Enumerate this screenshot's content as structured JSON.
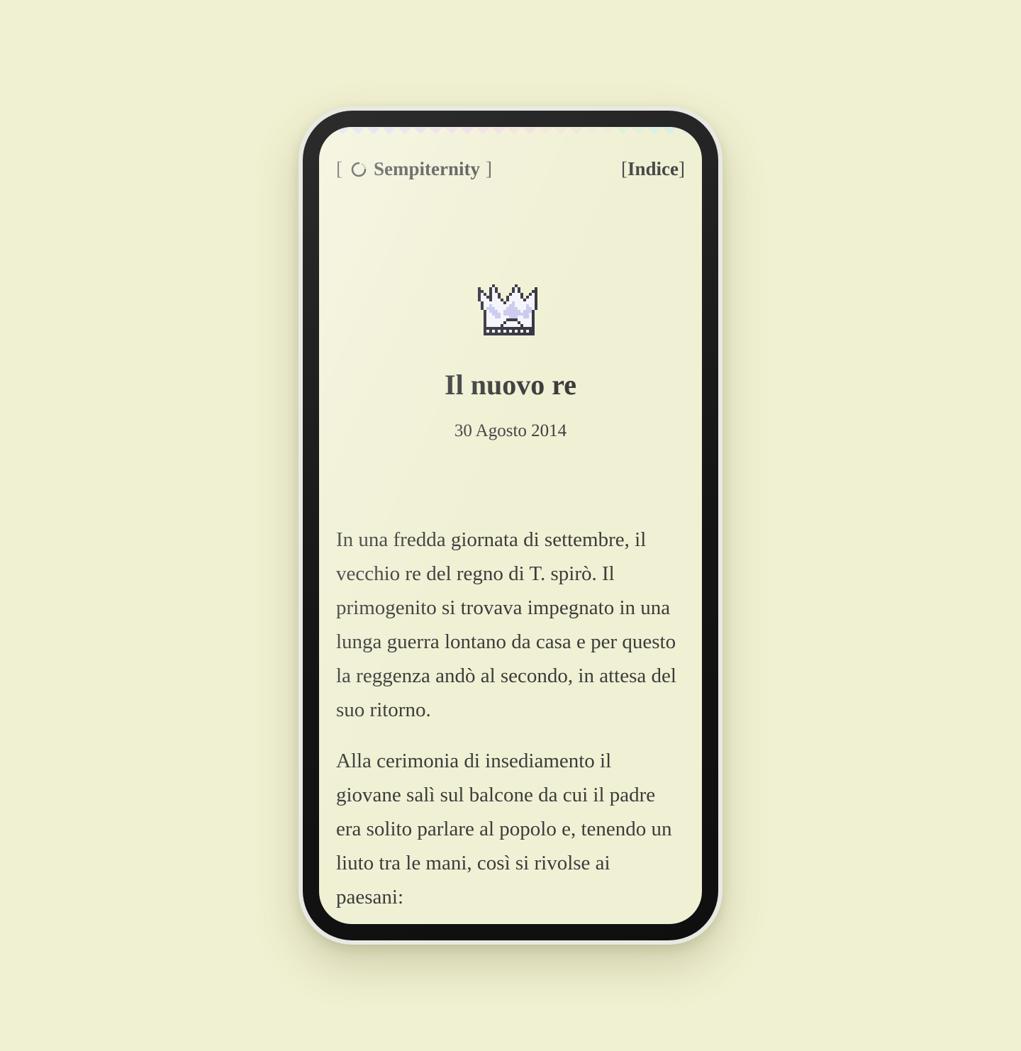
{
  "header": {
    "bracket_open": "[",
    "bracket_close": "]",
    "brand": "Sempiternity",
    "brand_icon": "loading-spinner-icon",
    "index_open": "[",
    "index_label": "Indice",
    "index_close": "]"
  },
  "post": {
    "icon": "pixel-crown-icon",
    "title": "Il nuovo re",
    "date": "30 Agosto 2014",
    "paragraphs": [
      "In una fredda giornata di settembre, il vecchio re del regno di T. spirò. Il primogenito si trovava impegnato in una lunga guerra lontano da casa e per questo la reggenza andò al secondo, in attesa del suo ritorno.",
      "Alla cerimonia di insediamento il giovane salì sul balcone da cui il padre era solito parlare al popolo e, tenendo un liuto tra le mani, così si rivolse ai paesani:"
    ]
  },
  "colors": {
    "page_background": "#f0f0d2",
    "screen_background": "#f0f0d4",
    "text": "#3c3c3c",
    "crown_fill": "#c7c8ee",
    "crown_outline": "#2e2e3a",
    "bezel": "#151515"
  }
}
